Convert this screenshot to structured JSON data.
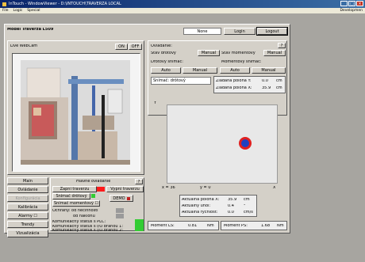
{
  "titlebar": {
    "title": "InTouch - WindowViewer - D:\\INTOUCH\\TRAVERZA LOCAL"
  },
  "menubar": {
    "items": [
      "File",
      "Logic",
      "Special"
    ],
    "right": "Developmen"
  },
  "header": {
    "model": "Model Traverza L509",
    "user": "None",
    "login": "Login",
    "logout": "Logout"
  },
  "webcam": {
    "title": "Live WebCam",
    "on": "ON",
    "off": "OFF"
  },
  "nav": {
    "items": [
      "Main",
      "Ovládanie",
      "Konfigurácia",
      "Kalibrácia",
      "Alarmy ☐",
      "Trendy",
      "Vizualizácia"
    ]
  },
  "control": {
    "help": "?",
    "title": "Ovládanie:",
    "wire_state": "Stav drôtový",
    "manual1": "Manual",
    "moment_state": "Stav momentový",
    "manual2": "Manual",
    "wire_sensor": "Drôtový snímač:",
    "moment_sensor": "Momentový snímač:",
    "auto1": "Auto",
    "manual3": "Manual",
    "auto2": "Auto",
    "manual4": "Manual",
    "sensor_label": "Snímač: drôtový",
    "req_y_label": "Žiadaná poloha Y:",
    "req_y_val": "0.0",
    "req_y_unit": "cm",
    "req_x_label": "Žiadaná poloha X:",
    "req_x_val": "35.9",
    "req_x_unit": "cm"
  },
  "main": {
    "title": "Hlavné ovládanie",
    "help": "?",
    "on": "Zapni traverzu",
    "off": "Vypni traverzu",
    "wire_sensor": "Snímač drôtový",
    "demo": "DEMO",
    "moment_sensor": "Snímač momentový ☐",
    "protect1": "Ochrany:  od nečinnosti",
    "protect2": "od náklonu",
    "comm_plc": "Komunikačný status s PLC:",
    "comm_io1": "Komunikačný status s I/O bránou 1:",
    "comm_io2": "Komunikačný status s I/O bránou 2:"
  },
  "plot": {
    "y_label": "Y",
    "x_label": "X",
    "x_readout": "x = 36",
    "y_readout": "y = 0"
  },
  "position": {
    "pos_label": "Aktuálna poloha X:",
    "pos_val": "35.9",
    "pos_unit": "cm",
    "angle_label": "Aktuálny uhol:",
    "angle_val": "0.4",
    "angle_unit": "°",
    "speed_label": "Aktuálna rýchlosť:",
    "speed_val": "0.0",
    "speed_unit": "cm/s"
  },
  "moments": {
    "ls_label": "Moment LS:",
    "ls_val": "0.81",
    "ls_unit": "Nm",
    "ps_label": "Moment PS:",
    "ps_val": "1.68",
    "ps_unit": "Nm"
  },
  "colors": {
    "on_indicator": "#ff1a1a",
    "status_ok": "#33cc33",
    "target_outer": "#e02020",
    "target_inner": "#2040c0"
  }
}
